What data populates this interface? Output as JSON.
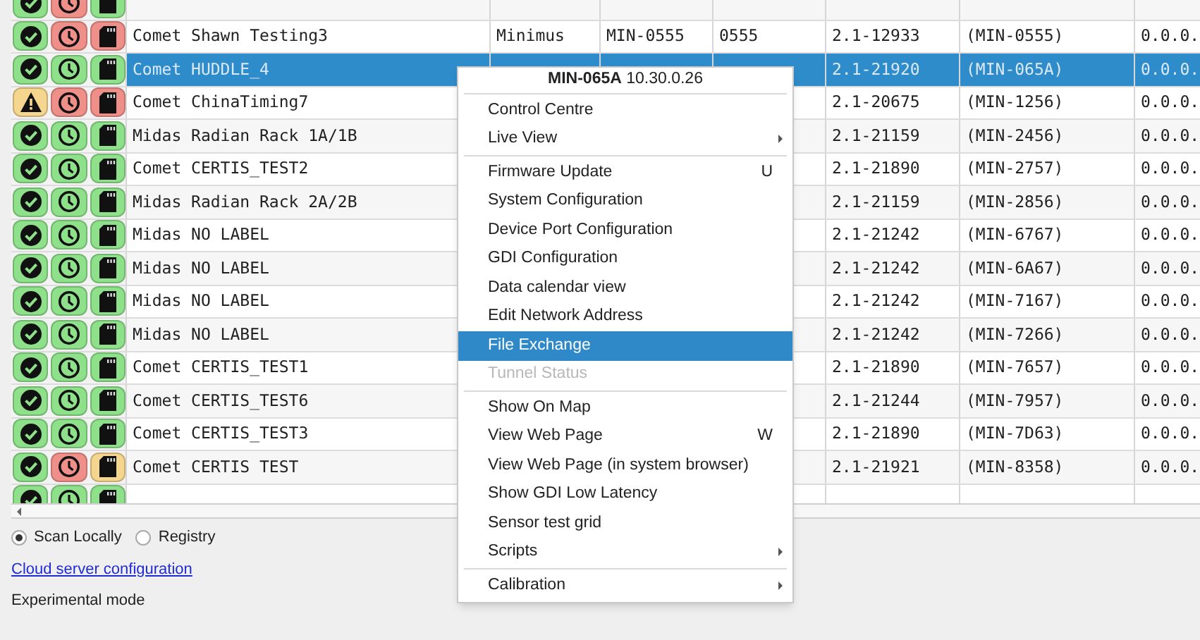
{
  "table": {
    "rows": [
      {
        "badges": [
          {
            "kind": "check",
            "color": "#8ee08a"
          },
          {
            "kind": "clock",
            "color": "#ef8f89"
          },
          {
            "kind": "card",
            "color": "#8ee08a"
          }
        ],
        "selected": false
      },
      {
        "badges": [
          {
            "kind": "check",
            "color": "#8ee08a"
          },
          {
            "kind": "clock",
            "color": "#ef8f89"
          },
          {
            "kind": "card",
            "color": "#ef8f89"
          }
        ],
        "selected": false,
        "name": "Comet Shawn Testing3",
        "model": "Minimus",
        "device": "MIN-0555",
        "serial": "0555",
        "version": "2.1-12933",
        "label": "(MIN-0555)",
        "ip": "0.0.0."
      },
      {
        "badges": [
          {
            "kind": "check",
            "color": "#8ee08a"
          },
          {
            "kind": "clock",
            "color": "#8ee08a"
          },
          {
            "kind": "card",
            "color": "#8ee08a"
          }
        ],
        "selected": true,
        "name": "Comet HUDDLE_4",
        "version": "2.1-21920",
        "label": "(MIN-065A)",
        "ip": "0.0.0."
      },
      {
        "badges": [
          {
            "kind": "warning",
            "color": "#f5d68e"
          },
          {
            "kind": "clock",
            "color": "#ef8f89"
          },
          {
            "kind": "card",
            "color": "#ef8f89"
          }
        ],
        "selected": false,
        "name": "Comet ChinaTiming7",
        "version": "2.1-20675",
        "label": "(MIN-1256)",
        "ip": "0.0.0."
      },
      {
        "badges": [
          {
            "kind": "check",
            "color": "#8ee08a"
          },
          {
            "kind": "clock",
            "color": "#8ee08a"
          },
          {
            "kind": "card",
            "color": "#8ee08a"
          }
        ],
        "selected": false,
        "name": "Midas Radian Rack 1A/1B",
        "version": "2.1-21159",
        "label": "(MIN-2456)",
        "ip": "0.0.0."
      },
      {
        "badges": [
          {
            "kind": "check",
            "color": "#8ee08a"
          },
          {
            "kind": "clock",
            "color": "#8ee08a"
          },
          {
            "kind": "card",
            "color": "#8ee08a"
          }
        ],
        "selected": false,
        "name": "Comet CERTIS_TEST2",
        "version": "2.1-21890",
        "label": "(MIN-2757)",
        "ip": "0.0.0."
      },
      {
        "badges": [
          {
            "kind": "check",
            "color": "#8ee08a"
          },
          {
            "kind": "clock",
            "color": "#8ee08a"
          },
          {
            "kind": "card",
            "color": "#8ee08a"
          }
        ],
        "selected": false,
        "name": "Midas Radian Rack 2A/2B",
        "version": "2.1-21159",
        "label": "(MIN-2856)",
        "ip": "0.0.0."
      },
      {
        "badges": [
          {
            "kind": "check",
            "color": "#8ee08a"
          },
          {
            "kind": "clock",
            "color": "#8ee08a"
          },
          {
            "kind": "card",
            "color": "#8ee08a"
          }
        ],
        "selected": false,
        "name": "Midas NO LABEL",
        "version": "2.1-21242",
        "label": "(MIN-6767)",
        "ip": "0.0.0."
      },
      {
        "badges": [
          {
            "kind": "check",
            "color": "#8ee08a"
          },
          {
            "kind": "clock",
            "color": "#8ee08a"
          },
          {
            "kind": "card",
            "color": "#8ee08a"
          }
        ],
        "selected": false,
        "name": "Midas NO LABEL",
        "version": "2.1-21242",
        "label": "(MIN-6A67)",
        "ip": "0.0.0."
      },
      {
        "badges": [
          {
            "kind": "check",
            "color": "#8ee08a"
          },
          {
            "kind": "clock",
            "color": "#8ee08a"
          },
          {
            "kind": "card",
            "color": "#8ee08a"
          }
        ],
        "selected": false,
        "name": "Midas NO LABEL",
        "version": "2.1-21242",
        "label": "(MIN-7167)",
        "ip": "0.0.0."
      },
      {
        "badges": [
          {
            "kind": "check",
            "color": "#8ee08a"
          },
          {
            "kind": "clock",
            "color": "#8ee08a"
          },
          {
            "kind": "card",
            "color": "#8ee08a"
          }
        ],
        "selected": false,
        "name": "Midas NO LABEL",
        "version": "2.1-21242",
        "label": "(MIN-7266)",
        "ip": "0.0.0."
      },
      {
        "badges": [
          {
            "kind": "check",
            "color": "#8ee08a"
          },
          {
            "kind": "clock",
            "color": "#8ee08a"
          },
          {
            "kind": "card",
            "color": "#8ee08a"
          }
        ],
        "selected": false,
        "name": "Comet CERTIS_TEST1",
        "version": "2.1-21890",
        "label": "(MIN-7657)",
        "ip": "0.0.0."
      },
      {
        "badges": [
          {
            "kind": "check",
            "color": "#8ee08a"
          },
          {
            "kind": "clock",
            "color": "#8ee08a"
          },
          {
            "kind": "card",
            "color": "#8ee08a"
          }
        ],
        "selected": false,
        "name": "Comet CERTIS_TEST6",
        "version": "2.1-21244",
        "label": "(MIN-7957)",
        "ip": "0.0.0."
      },
      {
        "badges": [
          {
            "kind": "check",
            "color": "#8ee08a"
          },
          {
            "kind": "clock",
            "color": "#8ee08a"
          },
          {
            "kind": "card",
            "color": "#8ee08a"
          }
        ],
        "selected": false,
        "name": "Comet CERTIS_TEST3",
        "version": "2.1-21890",
        "label": "(MIN-7D63)",
        "ip": "0.0.0."
      },
      {
        "badges": [
          {
            "kind": "check",
            "color": "#8ee08a"
          },
          {
            "kind": "clock",
            "color": "#ef8f89"
          },
          {
            "kind": "card",
            "color": "#f5d68e"
          }
        ],
        "selected": false,
        "name": "Comet CERTIS TEST",
        "version": "2.1-21921",
        "label": "(MIN-8358)",
        "ip": "0.0.0."
      },
      {
        "badges": [
          {
            "kind": "check",
            "color": "#8ee08a"
          },
          {
            "kind": "clock",
            "color": "#8ee08a"
          },
          {
            "kind": "card",
            "color": "#8ee08a"
          }
        ],
        "selected": false
      }
    ]
  },
  "context_menu": {
    "header": "**MIN-065A** 10.30.0.26",
    "items": [
      {
        "kind": "item",
        "label": "Control Centre",
        "disabled": false,
        "selected": false
      },
      {
        "kind": "submenu",
        "label": "Live View",
        "disabled": false,
        "selected": false
      },
      {
        "kind": "separator"
      },
      {
        "kind": "item",
        "label": "Firmware Update",
        "shortcut": "U",
        "disabled": false,
        "selected": false
      },
      {
        "kind": "item",
        "label": "System Configuration",
        "disabled": false,
        "selected": false
      },
      {
        "kind": "item",
        "label": "Device Port Configuration",
        "disabled": false,
        "selected": false
      },
      {
        "kind": "item",
        "label": "GDI Configuration",
        "disabled": false,
        "selected": false
      },
      {
        "kind": "item",
        "label": "Data calendar view",
        "disabled": false,
        "selected": false
      },
      {
        "kind": "item",
        "label": "Edit Network Address",
        "disabled": false,
        "selected": false
      },
      {
        "kind": "item",
        "label": "File Exchange",
        "disabled": false,
        "selected": true
      },
      {
        "kind": "item",
        "label": "Tunnel Status",
        "disabled": true,
        "selected": false
      },
      {
        "kind": "separator"
      },
      {
        "kind": "item",
        "label": "Show On Map",
        "disabled": false,
        "selected": false
      },
      {
        "kind": "item",
        "label": "View Web Page",
        "shortcut": "W",
        "disabled": false,
        "selected": false
      },
      {
        "kind": "item",
        "label": "View Web Page (in system browser)",
        "disabled": false,
        "selected": false
      },
      {
        "kind": "item",
        "label": "Show GDI Low Latency",
        "disabled": false,
        "selected": false
      },
      {
        "kind": "item",
        "label": "Sensor test grid",
        "disabled": false,
        "selected": false
      },
      {
        "kind": "submenu",
        "label": "Scripts",
        "disabled": false,
        "selected": false
      },
      {
        "kind": "separator"
      },
      {
        "kind": "submenu",
        "label": "Calibration",
        "disabled": false,
        "selected": false
      }
    ]
  },
  "scan_source": [
    {
      "label": "Scan Locally",
      "selected": true
    },
    {
      "label": "Registry",
      "selected": false
    }
  ],
  "cloud_link": "Cloud server configuration",
  "experimental_label": "Experimental mode"
}
